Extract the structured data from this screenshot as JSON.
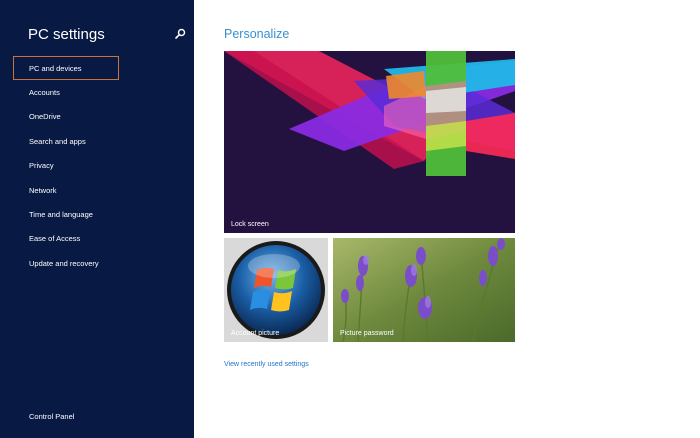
{
  "sidebar": {
    "title": "PC settings",
    "search_icon": "search-icon",
    "items": [
      {
        "label": "PC and devices",
        "selected": true
      },
      {
        "label": "Accounts"
      },
      {
        "label": "OneDrive"
      },
      {
        "label": "Search and apps"
      },
      {
        "label": "Privacy"
      },
      {
        "label": "Network"
      },
      {
        "label": "Time and language"
      },
      {
        "label": "Ease of Access"
      },
      {
        "label": "Update and recovery"
      }
    ],
    "control_panel": "Control Panel"
  },
  "main": {
    "title": "Personalize",
    "tiles": [
      {
        "label": "Lock screen"
      },
      {
        "label": "Account picture"
      },
      {
        "label": "Picture password"
      }
    ],
    "recent_link": "View recently used settings"
  },
  "colors": {
    "sidebar_bg": "#081a44",
    "accent": "#3a8fd0",
    "selection_border": "#c9733a"
  }
}
